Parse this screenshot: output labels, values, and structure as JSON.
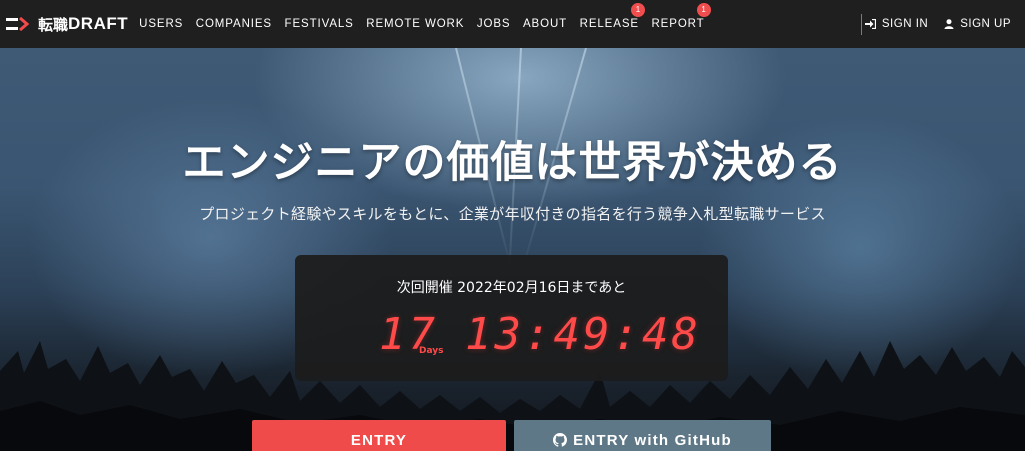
{
  "header": {
    "logo_jp": "転職",
    "logo_en": "DRAFT",
    "nav": [
      {
        "label": "USERS",
        "badge": null
      },
      {
        "label": "COMPANIES",
        "badge": null
      },
      {
        "label": "FESTIVALS",
        "badge": null
      },
      {
        "label": "REMOTE WORK",
        "badge": null
      },
      {
        "label": "JOBS",
        "badge": null
      },
      {
        "label": "ABOUT",
        "badge": null
      },
      {
        "label": "RELEASE",
        "badge": "1"
      },
      {
        "label": "REPORT",
        "badge": "1"
      }
    ],
    "sign_in": "SIGN IN",
    "sign_up": "SIGN UP",
    "icons": {
      "sign_in": "sign-in-icon",
      "sign_up": "user-icon"
    }
  },
  "hero": {
    "title": "エンジニアの価値は世界が決める",
    "subtitle": "プロジェクト経験やスキルをもとに、企業が年収付きの指名を行う競争入札型転職サービス"
  },
  "countdown": {
    "label": "次回開催 2022年02月16日まであと",
    "days": "17",
    "days_label": "Days",
    "time": "13:49:48"
  },
  "buttons": {
    "entry": "ENTRY",
    "entry_github": "ENTRY with GitHub",
    "github_icon": "github-icon"
  },
  "colors": {
    "accent_red": "#f04b4b",
    "github_button": "#5f7887",
    "navbar": "#1f1f1f",
    "countdown_digits": "#ff4a4a"
  }
}
